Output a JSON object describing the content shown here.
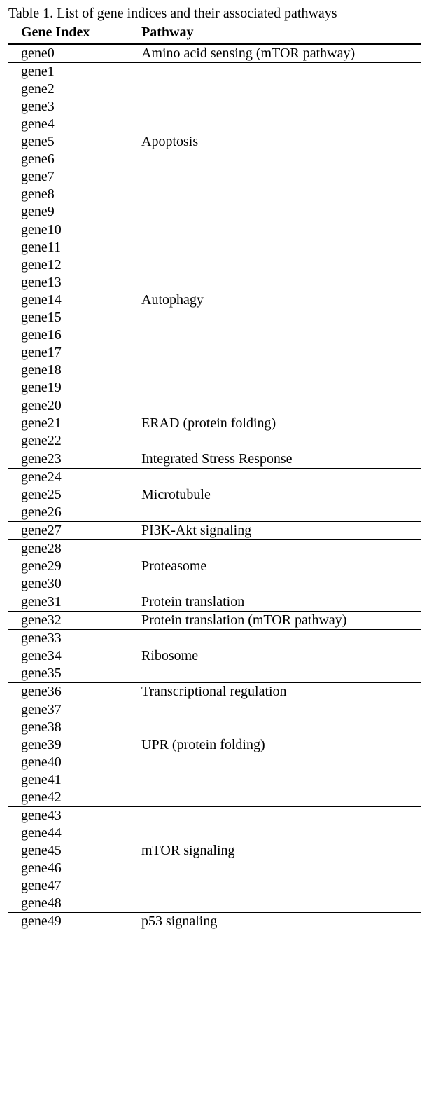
{
  "caption": "Table 1. List of gene indices and their associated pathways",
  "headers": {
    "col1": "Gene Index",
    "col2": "Pathway"
  },
  "groups": [
    {
      "pathway": "Amino acid sensing (mTOR pathway)",
      "genes": [
        "gene0"
      ]
    },
    {
      "pathway": "Apoptosis",
      "genes": [
        "gene1",
        "gene2",
        "gene3",
        "gene4",
        "gene5",
        "gene6",
        "gene7",
        "gene8",
        "gene9"
      ]
    },
    {
      "pathway": "Autophagy",
      "genes": [
        "gene10",
        "gene11",
        "gene12",
        "gene13",
        "gene14",
        "gene15",
        "gene16",
        "gene17",
        "gene18",
        "gene19"
      ]
    },
    {
      "pathway": "ERAD (protein folding)",
      "genes": [
        "gene20",
        "gene21",
        "gene22"
      ]
    },
    {
      "pathway": "Integrated Stress Response",
      "genes": [
        "gene23"
      ]
    },
    {
      "pathway": "Microtubule",
      "genes": [
        "gene24",
        "gene25",
        "gene26"
      ]
    },
    {
      "pathway": "PI3K-Akt signaling",
      "genes": [
        "gene27"
      ]
    },
    {
      "pathway": "Proteasome",
      "genes": [
        "gene28",
        "gene29",
        "gene30"
      ]
    },
    {
      "pathway": "Protein translation",
      "genes": [
        "gene31"
      ]
    },
    {
      "pathway": "Protein translation (mTOR pathway)",
      "genes": [
        "gene32"
      ]
    },
    {
      "pathway": "Ribosome",
      "genes": [
        "gene33",
        "gene34",
        "gene35"
      ]
    },
    {
      "pathway": "Transcriptional regulation",
      "genes": [
        "gene36"
      ]
    },
    {
      "pathway": "UPR (protein folding)",
      "genes": [
        "gene37",
        "gene38",
        "gene39",
        "gene40",
        "gene41",
        "gene42"
      ]
    },
    {
      "pathway": "mTOR signaling",
      "genes": [
        "gene43",
        "gene44",
        "gene45",
        "gene46",
        "gene47",
        "gene48"
      ]
    },
    {
      "pathway": "p53 signaling",
      "genes": [
        "gene49"
      ]
    }
  ]
}
